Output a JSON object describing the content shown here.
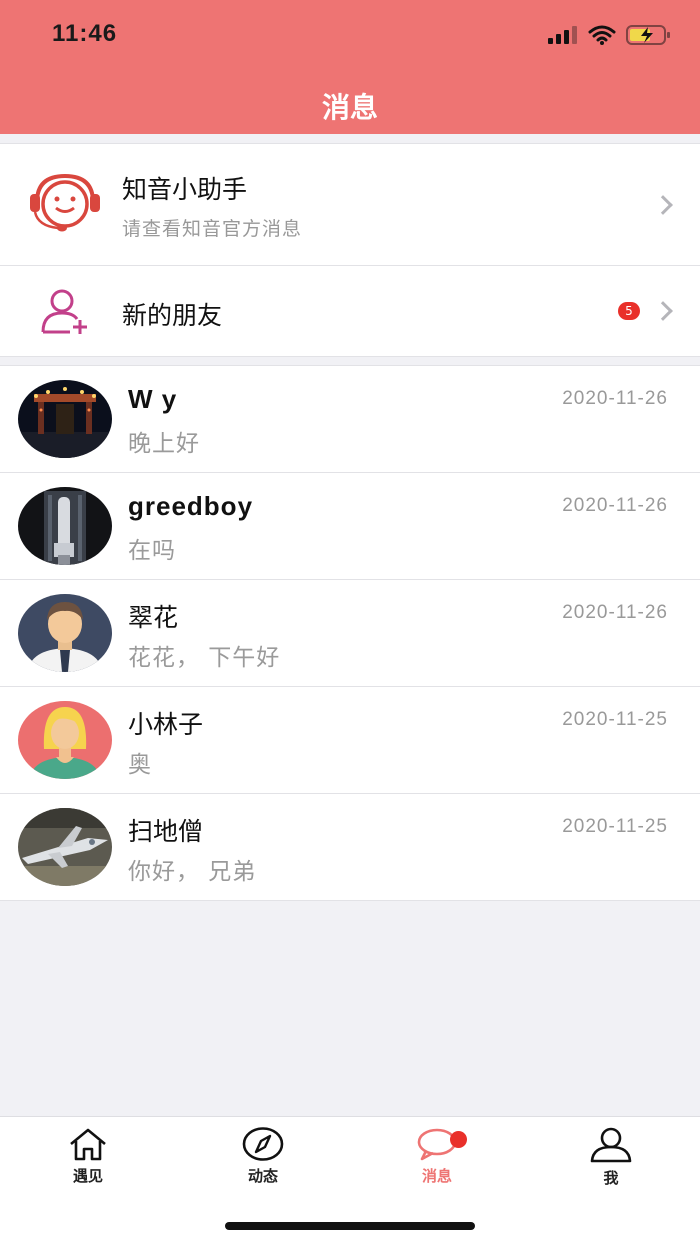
{
  "status_bar": {
    "time": "11:46"
  },
  "header": {
    "title": "消息"
  },
  "system_rows": [
    {
      "title": "知音小助手",
      "subtitle": "请查看知音官方消息",
      "icon": "headset-assistant-icon"
    },
    {
      "title": "新的朋友",
      "badge": "5",
      "icon": "add-friend-icon"
    }
  ],
  "chats": [
    {
      "name": "W y",
      "time": "2020-11-26",
      "message": "晚上好",
      "avatar": "night-gate-photo"
    },
    {
      "name": "greedboy",
      "time": "2020-11-26",
      "message": "在吗",
      "avatar": "rocket-photo"
    },
    {
      "name": "翠花",
      "time": "2020-11-26",
      "message": "花花， 下午好",
      "avatar": "man-cartoon-avatar"
    },
    {
      "name": "小林子",
      "time": "2020-11-25",
      "message": "奥",
      "avatar": "woman-cartoon-avatar"
    },
    {
      "name": "扫地僧",
      "time": "2020-11-25",
      "message": "你好， 兄弟",
      "avatar": "jet-photo"
    }
  ],
  "tabbar": {
    "tabs": [
      {
        "label": "遇见",
        "icon": "home-icon"
      },
      {
        "label": "动态",
        "icon": "compass-icon"
      },
      {
        "label": "消息",
        "icon": "chat-bubble-icon",
        "active": true
      },
      {
        "label": "我",
        "icon": "person-icon"
      }
    ]
  },
  "colors": {
    "accent": "#ee7473",
    "badge": "#e9302a"
  }
}
